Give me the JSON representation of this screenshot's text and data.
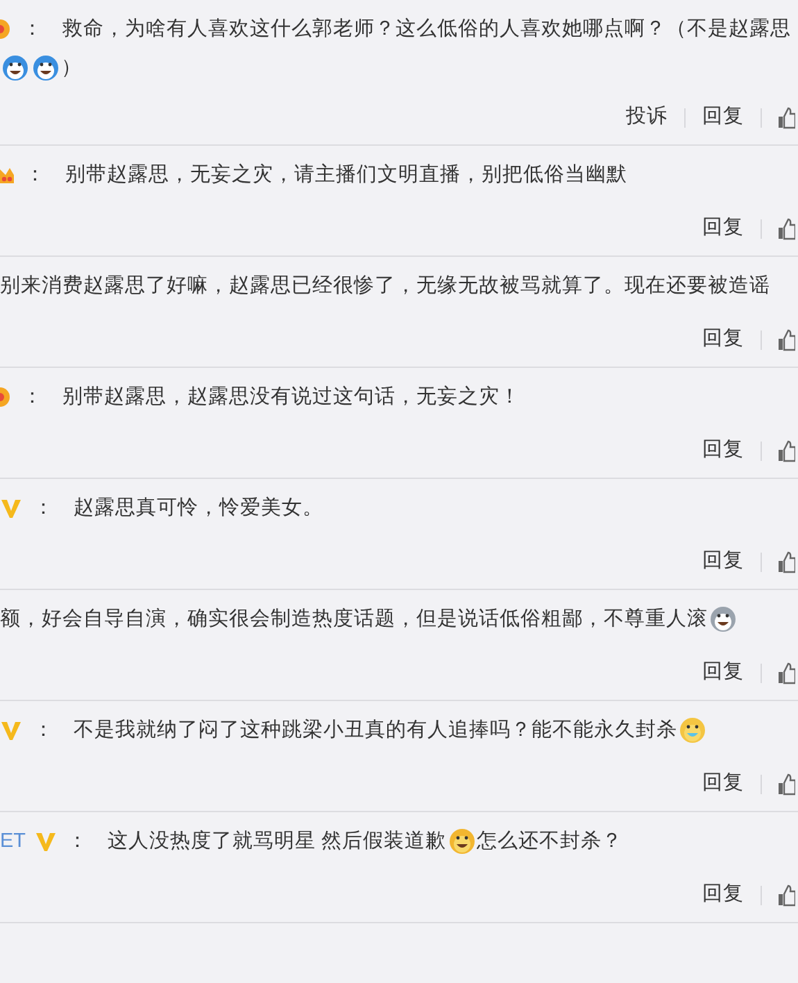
{
  "comments": [
    {
      "badge": {
        "kind": "dot"
      },
      "separator": "：",
      "lines": [
        [
          {
            "kind": "text",
            "text": "救命，为啥有人喜欢这什么郭老师？这么低俗的人喜欢她哪点啊？（不是赵露思"
          }
        ],
        [
          {
            "kind": "blue_face"
          },
          {
            "kind": "blue_face"
          },
          {
            "kind": "text",
            "text": "）"
          }
        ]
      ],
      "actions": [
        "投诉",
        "回复"
      ]
    },
    {
      "badge": {
        "kind": "crown"
      },
      "separator": "：",
      "lines": [
        [
          {
            "kind": "text",
            "text": "别带赵露思，无妄之灾，请主播们文明直播，别把低俗当幽默"
          }
        ]
      ],
      "actions": [
        "回复"
      ]
    },
    {
      "lines": [
        [
          {
            "kind": "text",
            "text": "别来消费赵露思了好嘛，赵露思已经很惨了，无缘无故被骂就算了。现在还要被造谣"
          }
        ]
      ],
      "actions": [
        "回复"
      ]
    },
    {
      "badge": {
        "kind": "dot"
      },
      "separator": "：",
      "lines": [
        [
          {
            "kind": "text",
            "text": "别带赵露思，赵露思没有说过这句话，无妄之灾！"
          }
        ]
      ],
      "actions": [
        "回复"
      ]
    },
    {
      "badge": {
        "kind": "v"
      },
      "separator": "：",
      "lines": [
        [
          {
            "kind": "text",
            "text": "赵露思真可怜，怜爱美女。"
          }
        ]
      ],
      "actions": [
        "回复"
      ]
    },
    {
      "lines": [
        [
          {
            "kind": "text",
            "text": "额，好会自导自演，确实很会制造热度话题，但是说话低俗粗鄙，不尊重人滚"
          },
          {
            "kind": "grey_face"
          }
        ]
      ],
      "actions": [
        "回复"
      ]
    },
    {
      "badge": {
        "kind": "v"
      },
      "separator": "：",
      "lines": [
        [
          {
            "kind": "text",
            "text": "不是我就纳了闷了这种跳梁小丑真的有人追捧吗？能不能永久封杀"
          },
          {
            "kind": "sick_face"
          }
        ]
      ],
      "actions": [
        "回复"
      ]
    },
    {
      "user": "ET",
      "badge": {
        "kind": "v"
      },
      "separator": "：",
      "lines": [
        [
          {
            "kind": "text",
            "text": "这人没热度了就骂明星 然后假装道歉 "
          },
          {
            "kind": "grin_face"
          },
          {
            "kind": "text",
            "text": "怎么还不封杀？"
          }
        ]
      ],
      "actions": [
        "回复"
      ]
    }
  ]
}
